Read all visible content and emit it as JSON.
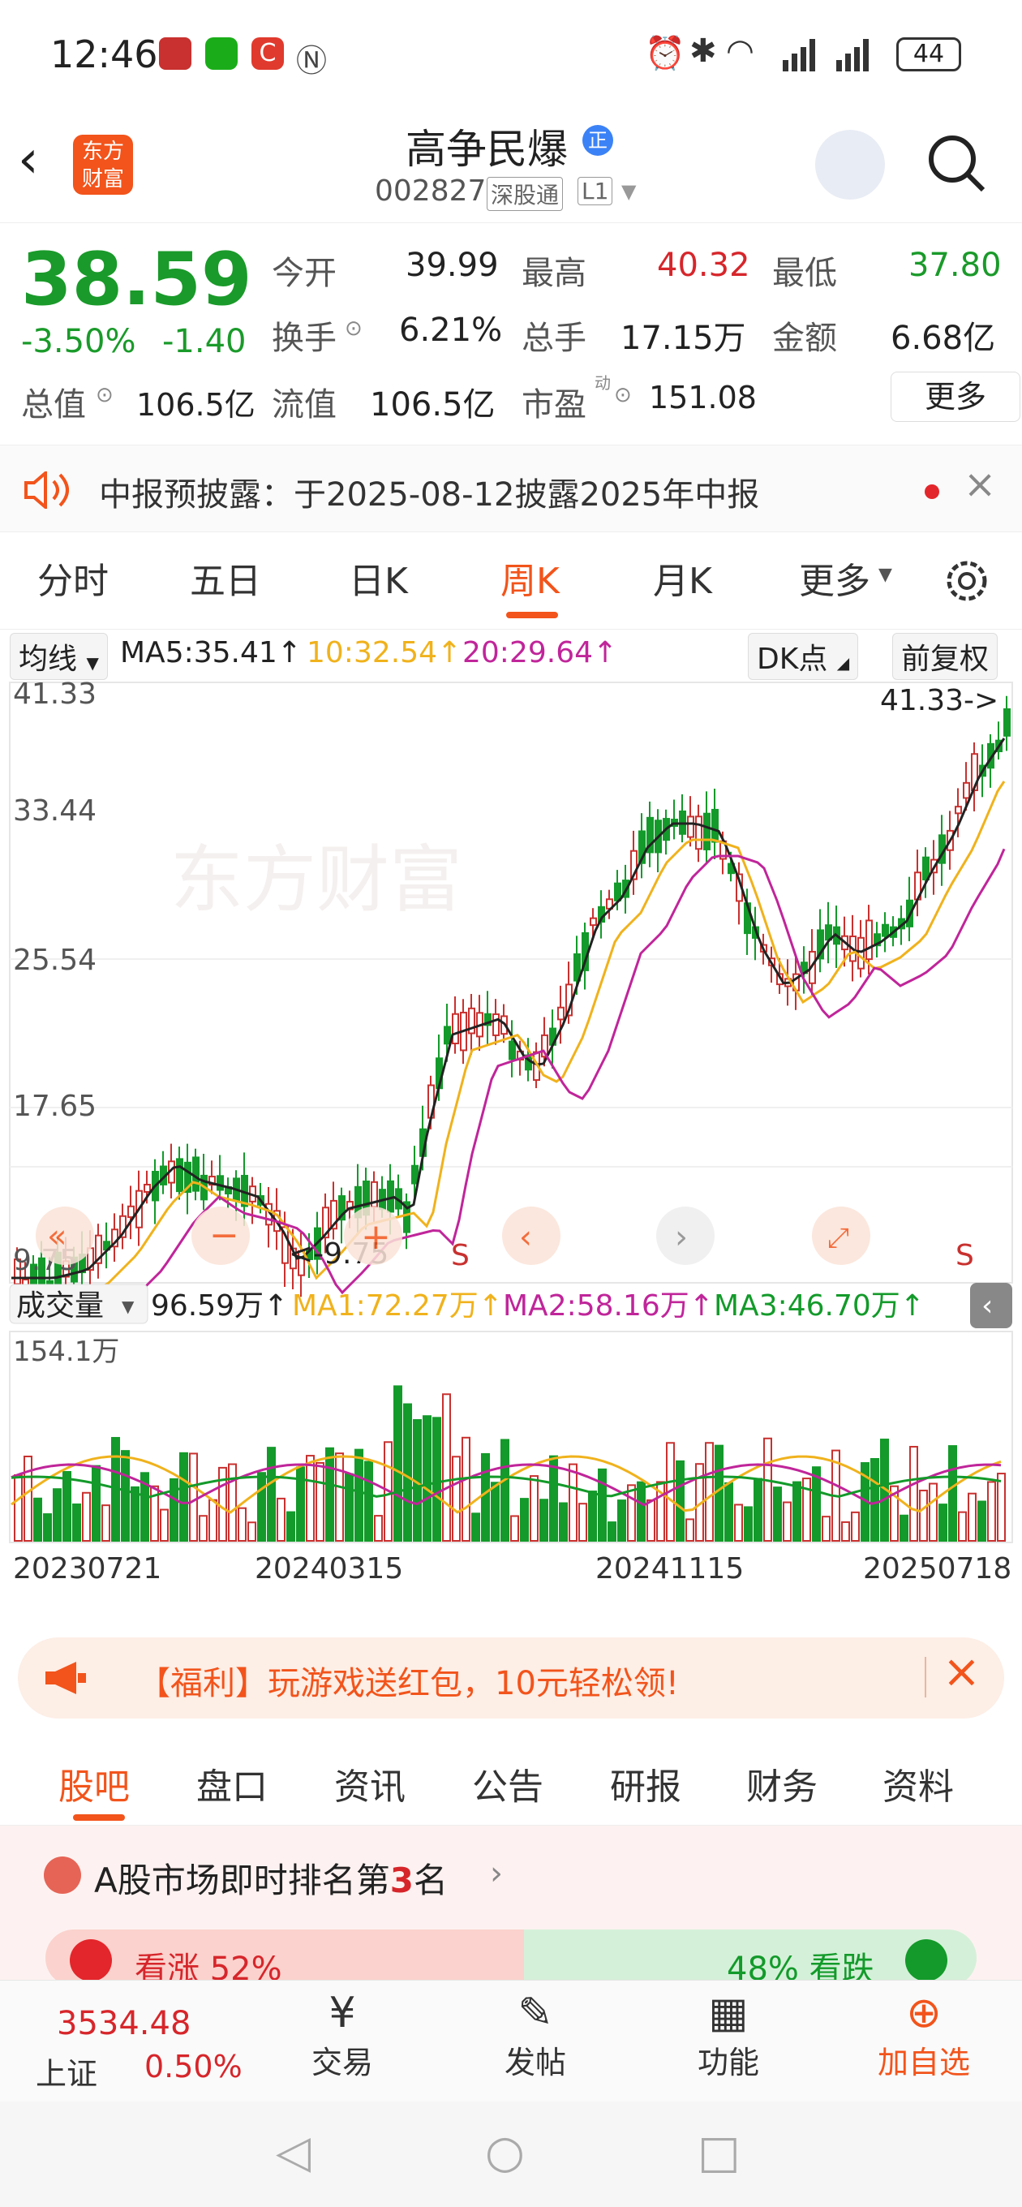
{
  "status": {
    "time": "12:46",
    "battery": "44"
  },
  "header": {
    "title": "高争民爆",
    "badge": "正",
    "code": "002827",
    "market": "深股通",
    "level": "L1",
    "logo_line1": "东方",
    "logo_line2": "财富"
  },
  "quote": {
    "price": "38.59",
    "change_pct": "-3.50%",
    "change": "-1.40",
    "open_label": "今开",
    "open": "39.99",
    "high_label": "最高",
    "high": "40.32",
    "low_label": "最低",
    "low": "37.80",
    "turnover_label": "换手",
    "turnover": "6.21%",
    "volume_label": "总手",
    "volume": "17.15万",
    "amount_label": "金额",
    "amount": "6.68亿",
    "mcap_label": "总值",
    "mcap": "106.5亿",
    "float_label": "流值",
    "float": "106.5亿",
    "pe_label": "市盈",
    "pe_sup": "动",
    "pe": "151.08",
    "more": "更多"
  },
  "notice": {
    "text": "中报预披露：于2025-08-12披露2025年中报"
  },
  "ktabs": [
    "分时",
    "五日",
    "日K",
    "周K",
    "月K",
    "更多"
  ],
  "ma_bar": {
    "selector": "均线",
    "ma5": "MA5:35.41↑",
    "ma10": "10:32.54↑",
    "ma20": "20:29.64↑",
    "dk": "DK点",
    "fq": "前复权"
  },
  "price_axis": [
    "41.33",
    "33.44",
    "25.54",
    "17.65",
    "9.75"
  ],
  "price_annot": {
    "max": "41.33->",
    "min": "<-9.75",
    "s": "S"
  },
  "vol_bar": {
    "selector": "成交量",
    "val": "96.59万↑",
    "ma1": "MA1:72.27万↑",
    "ma2": "MA2:58.16万↑",
    "ma3": "MA3:46.70万↑",
    "max": "154.1万"
  },
  "dates": [
    "20230721",
    "20240315",
    "20241115",
    "20250718"
  ],
  "colors": {
    "up": "#c8312f",
    "down": "#139a2a",
    "ma5": "#222222",
    "ma10": "#f0b21c",
    "ma20": "#c0259a",
    "accent": "#f2541b"
  },
  "banner": {
    "text": "【福利】玩游戏送红包，10元轻松领!"
  },
  "btabs": [
    "股吧",
    "盘口",
    "资讯",
    "公告",
    "研报",
    "财务",
    "资料"
  ],
  "rank": {
    "title_pre": "A股市场即时排名第",
    "rank": "3",
    "title_post": "名",
    "up": "看涨 52%",
    "down": "48% 看跌"
  },
  "bottom": {
    "index_value": "3534.48",
    "index_name": "上证",
    "index_pct": "0.50%",
    "trade": "交易",
    "post": "发帖",
    "func": "功能",
    "add": "加自选"
  }
}
